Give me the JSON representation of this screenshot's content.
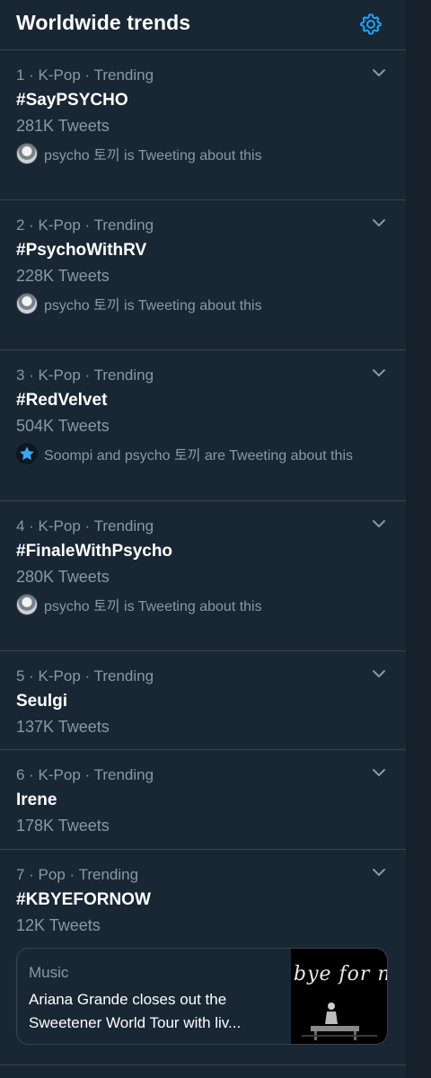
{
  "header": {
    "title": "Worldwide trends",
    "settings_icon": "gear-icon",
    "accent": "#1da1f2"
  },
  "trends": [
    {
      "meta": "1 · K-Pop · Trending",
      "name": "#SayPSYCHO",
      "count": "281K Tweets",
      "tweeting": "psycho 토끼 is Tweeting about this",
      "tweeting_avatar": "user-avatar"
    },
    {
      "meta": "2 · K-Pop · Trending",
      "name": "#PsychoWithRV",
      "count": "228K Tweets",
      "tweeting": "psycho 토끼 is Tweeting about this",
      "tweeting_avatar": "user-avatar"
    },
    {
      "meta": "3 · K-Pop · Trending",
      "name": "#RedVelvet",
      "count": "504K Tweets",
      "tweeting": "Soompi and psycho 토끼 are Tweeting about this",
      "tweeting_avatar": "star-icon"
    },
    {
      "meta": "4 · K-Pop · Trending",
      "name": "#FinaleWithPsycho",
      "count": "280K Tweets",
      "tweeting": "psycho 토끼 is Tweeting about this",
      "tweeting_avatar": "user-avatar"
    },
    {
      "meta": "5 · K-Pop · Trending",
      "name": "Seulgi",
      "count": "137K Tweets"
    },
    {
      "meta": "6 · K-Pop · Trending",
      "name": "Irene",
      "count": "178K Tweets"
    },
    {
      "meta": "7 · Pop · Trending",
      "name": "#KBYEFORNOW",
      "count": "12K Tweets",
      "card": {
        "category": "Music",
        "headline": "Ariana Grande closes out the Sweetener World Tour with liv...",
        "thumbnail_text": "bye for now"
      }
    }
  ],
  "colors": {
    "panel_bg": "#192734",
    "page_bg": "#15202b",
    "divider": "#38444d",
    "secondary_text": "#8899a6",
    "primary_text": "#ffffff"
  }
}
